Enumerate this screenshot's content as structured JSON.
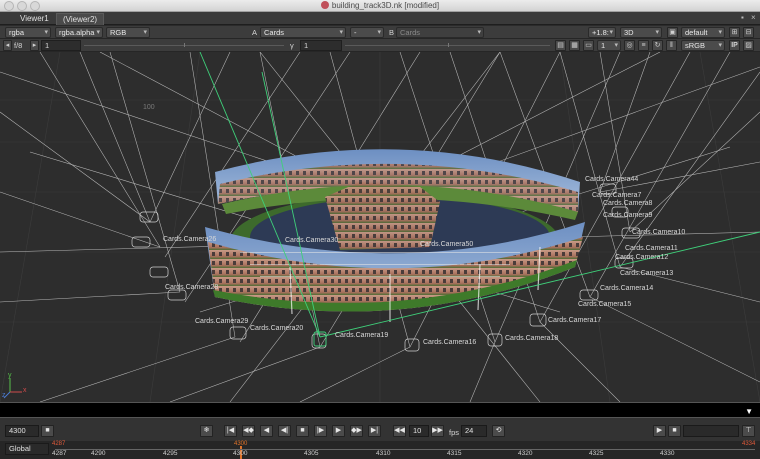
{
  "window": {
    "title": "building_track3D.nk [modified]"
  },
  "tabs": [
    {
      "label": "Viewer1",
      "active": false
    },
    {
      "label": "(Viewer2)",
      "active": true
    }
  ],
  "tab_controls": {
    "close_glyph": "×",
    "menu_glyph": "▪"
  },
  "toolbar1": {
    "channels": "rgba",
    "alpha_channel": "rgba.alpha",
    "colorspace_view": "RGB",
    "input_a_label": "A",
    "input_a": "Cards",
    "composite_op": "-",
    "input_b_label": "B",
    "input_b": "Cards",
    "zoom": "+1.8:",
    "view_mode": "3D",
    "viewer_preset": "default"
  },
  "toolbar2": {
    "fstop_label": "f/8",
    "gain_value": "1",
    "gamma_label": "γ",
    "gamma_value": "1",
    "proxy_value": "1",
    "lut": "sRGB",
    "ip_label": "IP"
  },
  "viewport": {
    "grid_label": "100",
    "camera_labels": [
      "Cards.Camera44",
      "Cards.Camera7",
      "Cards.Camera8",
      "Cards.Camera9",
      "Cards.Camera10",
      "Cards.Camera11",
      "Cards.Camera12",
      "Cards.Camera13",
      "Cards.Camera14",
      "Cards.Camera15",
      "Cards.Camera17",
      "Cards.Camera18",
      "Cards.Camera16",
      "Cards.Camera19",
      "Cards.Camera20",
      "Cards.Camera26",
      "Cards.Camera28",
      "Cards.Camera50",
      "Cards.Camera29",
      "Cards.Camera30"
    ],
    "axis_labels": {
      "x": "x",
      "y": "y",
      "z": "z"
    }
  },
  "playback": {
    "current_frame": "4300",
    "step_increment": "10",
    "fps_label": "fps",
    "fps_value": "24",
    "range_mode": "Global"
  },
  "timeline": {
    "ticks": [
      "4287",
      "4290",
      "4295",
      "4300",
      "4305",
      "4310",
      "4315",
      "4320",
      "4325",
      "4330"
    ],
    "start_marker": "4287",
    "current_marker": "4300",
    "end_marker": "4334"
  },
  "colors": {
    "viewport_bg": "#2d2d2d",
    "wireframe": "#d9d9d9",
    "selection": "#3fd07a",
    "timeline_marker": "#e0742a"
  }
}
